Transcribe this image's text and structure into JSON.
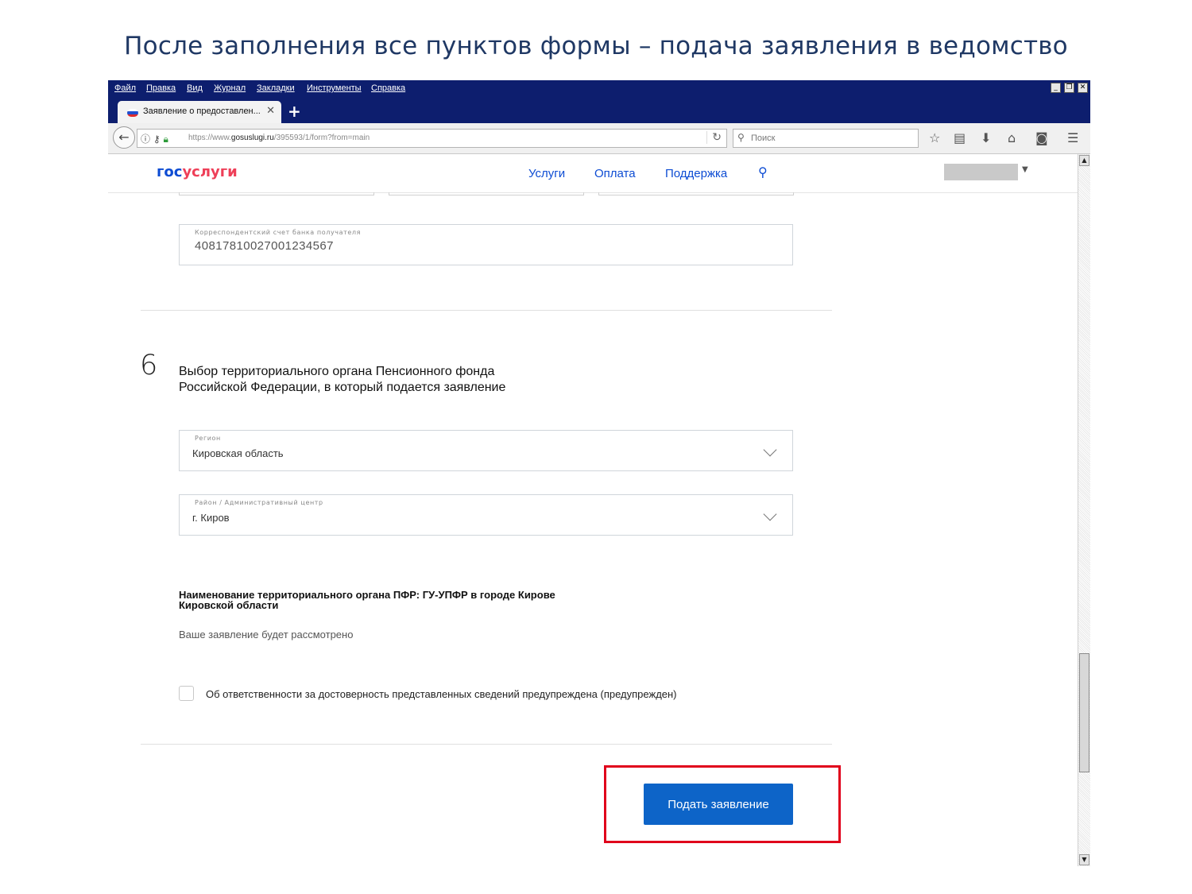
{
  "slide": {
    "title": "После заполнения все пунктов формы – подача заявления в ведомство"
  },
  "browser": {
    "menu": [
      "Файл",
      "Правка",
      "Вид",
      "Журнал",
      "Закладки",
      "Инструменты",
      "Справка"
    ],
    "tab_title": "Заявление о предоставлен...",
    "url_prefix": "https://www.",
    "url_domain": "gosuslugi.ru",
    "url_path": "/395593/1/form?from=main",
    "search_placeholder": "Поиск"
  },
  "site": {
    "logo_part1": "гос",
    "logo_part2": "услуги",
    "nav": [
      "Услуги",
      "Оплата",
      "Поддержка"
    ]
  },
  "form": {
    "corr_account": {
      "label": "Корреспондентский счет банка получателя",
      "value": "40817810027001234567"
    },
    "step": {
      "number": "6",
      "title": "Выбор территориального органа Пенсионного фонда Российской Федерации, в который подается заявление"
    },
    "region": {
      "label": "Регион",
      "value": "Кировская область"
    },
    "district": {
      "label": "Район / Административный центр",
      "value": "г. Киров"
    },
    "org_name": "Наименование территориального органа ПФР: ГУ-УПФР в городе Кирове Кировской области",
    "review_note": "Ваше заявление будет рассмотрено",
    "responsibility_label": "Об ответственности за достоверность представленных сведений предупреждена (предупрежден)",
    "submit_label": "Подать заявление"
  },
  "colors": {
    "brand_blue": "#0d4cd3",
    "brand_red": "#ee3f58",
    "button_blue": "#0d64c8",
    "highlight_red": "#e0001b",
    "title_navy": "#1f3864"
  }
}
